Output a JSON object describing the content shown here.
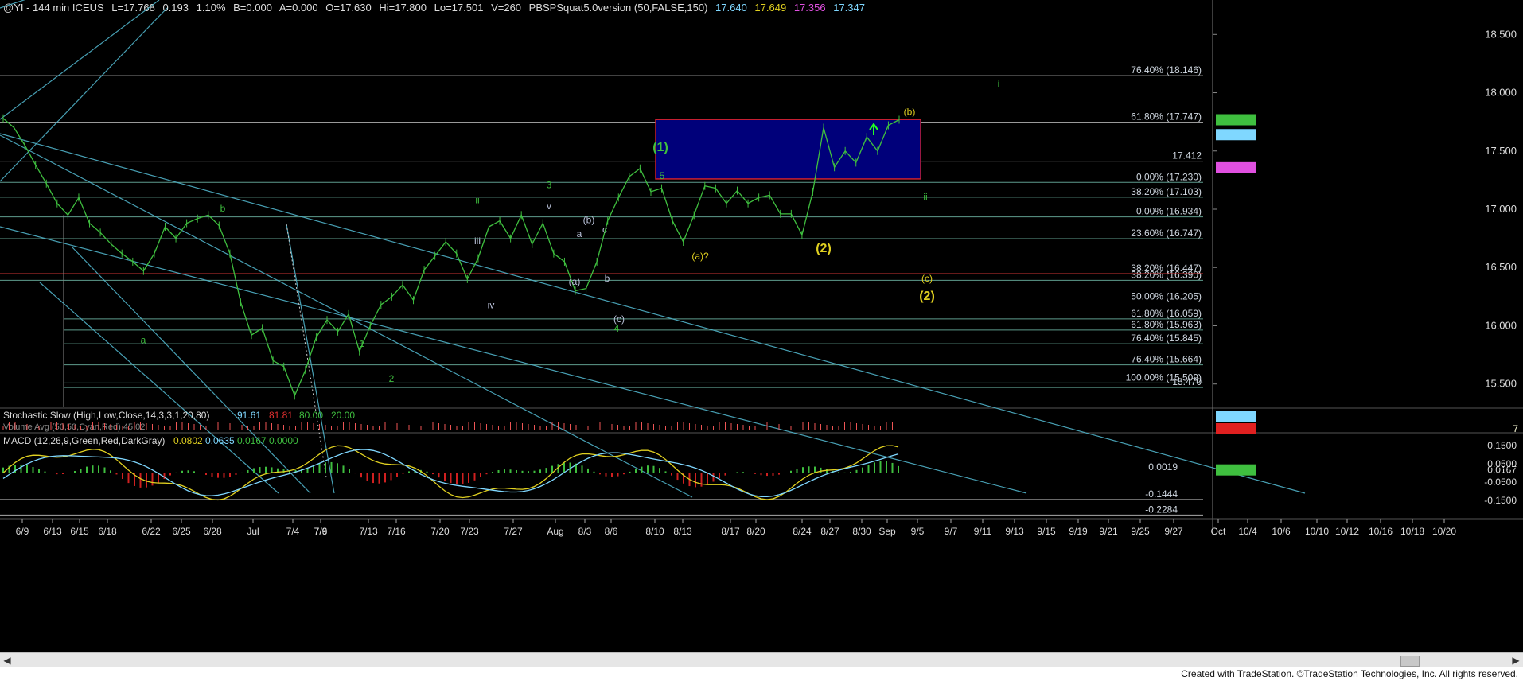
{
  "header": {
    "symbol": "@YI - 144 min ICEUS",
    "last": "L=17.768",
    "change": "0.193",
    "change_pct": "1.10%",
    "bid": "B=0.000",
    "ask": "A=0.000",
    "open": "O=17.630",
    "high": "Hi=17.800",
    "low": "Lo=17.501",
    "volume": "V=260",
    "study": "PBSPSquat5.0version (50,FALSE,150)",
    "study_v1": "17.640",
    "study_v2": "17.649",
    "study_v3": "17.356",
    "study_v4": "17.347"
  },
  "footer": "Created with TradeStation. ©TradeStation Technologies, Inc. All rights reserved.",
  "colors": {
    "price": "#3fbf3f",
    "grid": "#3a3a3a",
    "trend": "#4fb0c6",
    "box_fill": "#00007a",
    "box_border": "#cc2030",
    "yellow": "#e0d020"
  },
  "chart_data": [
    {
      "type": "line",
      "title": "@YI - 144 min ICEUS",
      "x_tick_labels": [
        "6/9",
        "6/13",
        "6/15",
        "6/18",
        "6/22",
        "6/25",
        "6/28",
        "Jul",
        "7/4",
        "7/6",
        "7/9",
        "7/13",
        "7/16",
        "7/20",
        "7/23",
        "7/27",
        "Aug",
        "8/3",
        "8/6",
        "8/10",
        "8/13",
        "8/17",
        "8/20",
        "8/24",
        "8/27",
        "8/30",
        "Sep",
        "9/5",
        "9/7",
        "9/11",
        "9/13",
        "9/15",
        "9/19",
        "9/21",
        "9/25",
        "9/27",
        "Oct",
        "10/4",
        "10/6",
        "10/10",
        "10/12",
        "10/16",
        "10/18",
        "10/20"
      ],
      "y_axis_labels": [
        "18.500",
        "18.000",
        "17.500",
        "17.000",
        "16.500",
        "16.000",
        "15.500"
      ],
      "ylim": [
        15.3,
        18.7
      ],
      "price_tags": [
        {
          "value": "17.768",
          "color": "#3fbf3f"
        },
        {
          "value": "17.640",
          "color": "#7fd7ff"
        },
        {
          "value": "17.356",
          "color": "#e050e0"
        }
      ],
      "price_path": [
        17.78,
        17.7,
        17.55,
        17.38,
        17.22,
        17.05,
        16.95,
        17.1,
        16.88,
        16.8,
        16.7,
        16.62,
        16.55,
        16.47,
        16.62,
        16.85,
        16.75,
        16.88,
        16.92,
        16.95,
        16.86,
        16.62,
        16.2,
        15.92,
        15.98,
        15.7,
        15.65,
        15.4,
        15.62,
        15.9,
        16.05,
        15.95,
        16.1,
        15.78,
        16.0,
        16.18,
        16.25,
        16.35,
        16.22,
        16.48,
        16.6,
        16.72,
        16.62,
        16.4,
        16.58,
        16.85,
        16.9,
        16.75,
        16.95,
        16.7,
        16.88,
        16.62,
        16.55,
        16.3,
        16.32,
        16.55,
        16.9,
        17.1,
        17.28,
        17.35,
        17.15,
        17.18,
        16.9,
        16.72,
        16.95,
        17.2,
        17.18,
        17.05,
        17.16,
        17.05,
        17.1,
        17.12,
        16.96,
        16.96,
        16.78,
        17.15,
        17.7,
        17.36,
        17.5,
        17.4,
        17.62,
        17.5,
        17.72,
        17.768
      ],
      "fibonacci_levels": [
        {
          "label": "76.40% (18.146)",
          "value": 18.146
        },
        {
          "label": "61.80% (17.747)",
          "value": 17.747
        },
        {
          "label": "17.412",
          "value": 17.412
        },
        {
          "label": "0.00% (17.230)",
          "value": 17.23
        },
        {
          "label": "38.20% (17.103)",
          "value": 17.103
        },
        {
          "label": "0.00% (16.934)",
          "value": 16.934
        },
        {
          "label": "23.60% (16.747)",
          "value": 16.747
        },
        {
          "label": "38.20% (16.447)",
          "value": 16.447
        },
        {
          "label": "38.20% (16.390)",
          "value": 16.39
        },
        {
          "label": "50.00% (16.205)",
          "value": 16.205
        },
        {
          "label": "61.80% (16.059)",
          "value": 16.059
        },
        {
          "label": "61.80% (15.963)",
          "value": 15.963
        },
        {
          "label": "76.40% (15.845)",
          "value": 15.845
        },
        {
          "label": "76.40% (15.664)",
          "value": 15.664
        },
        {
          "label": "100.00% (15.509)",
          "value": 15.509
        },
        {
          "label": "15.470",
          "value": 15.47
        }
      ],
      "wave_labels": [
        {
          "text": "a",
          "value": 15.85
        },
        {
          "text": "b",
          "value": 16.98
        },
        {
          "text": "1",
          "value": 15.82
        },
        {
          "text": "2",
          "value": 15.52
        },
        {
          "text": "3",
          "value": 17.18
        },
        {
          "text": "4",
          "value": 15.95
        },
        {
          "text": "i",
          "value": 16.7
        },
        {
          "text": "ii",
          "value": 17.05
        },
        {
          "text": "iii",
          "value": 16.7
        },
        {
          "text": "iv",
          "value": 16.15
        },
        {
          "text": "v",
          "value": 17.0
        },
        {
          "text": "(a)",
          "value": 16.35
        },
        {
          "text": "b",
          "value": 16.38
        },
        {
          "text": "(b)",
          "value": 16.88
        },
        {
          "text": "a",
          "value": 16.76
        },
        {
          "text": "c",
          "value": 16.8
        },
        {
          "text": "(c)",
          "value": 16.03
        },
        {
          "text": "(1)",
          "value": 17.5
        },
        {
          "text": "5",
          "value": 17.26
        },
        {
          "text": "(a)?",
          "value": 16.57
        },
        {
          "text": "(2)",
          "value": 16.63
        },
        {
          "text": "(b)",
          "value": 17.81
        },
        {
          "text": "i",
          "value": 18.05
        },
        {
          "text": "ii",
          "value": 17.08
        },
        {
          "text": "(c)",
          "value": 16.38
        },
        {
          "text": "(2)",
          "value": 16.22
        }
      ]
    },
    {
      "type": "line",
      "title": "Stochastic Slow (High,Low,Close,14,3,3,1,20,80)",
      "series": [
        {
          "name": "SlowK",
          "value": 91.61
        },
        {
          "name": "SlowD",
          "value": 81.81
        },
        {
          "name": "OverBought",
          "value": 80.0
        },
        {
          "name": "OverSold",
          "value": 20.0
        }
      ],
      "tags": [
        "91.61",
        "7"
      ],
      "overlap_text": "Volume Avg (50,50,Cyan,Red) 45.02"
    },
    {
      "type": "line",
      "title": "MACD (12,26,9,Green,Red,DarkGray)",
      "series": [
        {
          "name": "MACD",
          "value": 0.0802
        },
        {
          "name": "MACDAvg",
          "value": 0.0635
        },
        {
          "name": "MACDDiff",
          "value": 0.0167
        },
        {
          "name": "ZeroLine",
          "value": 0.0
        }
      ],
      "header_values": [
        "0.0802",
        "0.0635",
        "0.0167",
        "0.0000"
      ],
      "y_axis_labels": [
        "0.1500",
        "0.0500",
        "0.0167",
        "-0.0500",
        "-0.1500"
      ],
      "level_labels": [
        "0.0019",
        "-0.1444",
        "-0.2284"
      ],
      "ylim": [
        -0.24,
        0.21
      ]
    }
  ]
}
